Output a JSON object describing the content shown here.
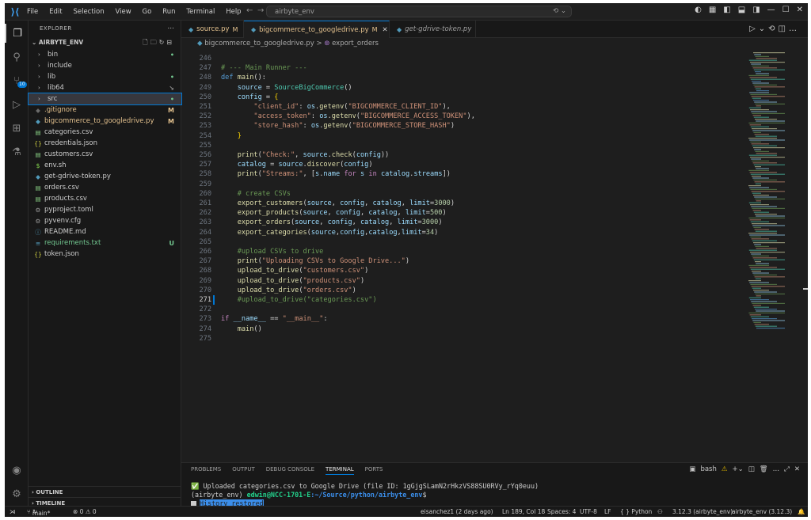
{
  "title_bar": {
    "menu": [
      "File",
      "Edit",
      "Selection",
      "View",
      "Go",
      "Run",
      "Terminal",
      "Help"
    ],
    "command_center": "airbyte_env",
    "back_icon": "arrow-left-icon",
    "forward_icon": "arrow-right-icon"
  },
  "sidebar": {
    "title": "EXPLORER",
    "root": "AIRBYTE_ENV",
    "more": "...",
    "items": [
      {
        "name": "bin",
        "kind": "folder",
        "status": "•",
        "status_color": "#73c991"
      },
      {
        "name": "include",
        "kind": "folder",
        "status": "",
        "status_color": ""
      },
      {
        "name": "lib",
        "kind": "folder",
        "status": "•",
        "status_color": "#73c991"
      },
      {
        "name": "lib64",
        "kind": "folder",
        "status": "↘",
        "status_color": "#8b8b8b"
      },
      {
        "name": "src",
        "kind": "folder",
        "status": "•",
        "status_color": "#73c991"
      },
      {
        "name": ".gitignore",
        "kind": "file",
        "icon": "◆",
        "icon_color": "#6b6b6b",
        "status": "M",
        "status_color": "#e2c08d"
      },
      {
        "name": "bigcommerce_to_googledrive.py",
        "kind": "file",
        "icon": "◆",
        "icon_color": "#519aba",
        "status": "M",
        "status_color": "#e2c08d"
      },
      {
        "name": "categories.csv",
        "kind": "file",
        "icon": "▤",
        "icon_color": "#89d185",
        "status": "",
        "status_color": ""
      },
      {
        "name": "credentials.json",
        "kind": "file",
        "icon": "{}",
        "icon_color": "#cbcb41",
        "status": "",
        "status_color": ""
      },
      {
        "name": "customers.csv",
        "kind": "file",
        "icon": "▤",
        "icon_color": "#89d185",
        "status": "",
        "status_color": ""
      },
      {
        "name": "env.sh",
        "kind": "file",
        "icon": "$",
        "icon_color": "#89e051",
        "status": "",
        "status_color": ""
      },
      {
        "name": "get-gdrive-token.py",
        "kind": "file",
        "icon": "◆",
        "icon_color": "#519aba",
        "status": "",
        "status_color": ""
      },
      {
        "name": "orders.csv",
        "kind": "file",
        "icon": "▤",
        "icon_color": "#89d185",
        "status": "",
        "status_color": ""
      },
      {
        "name": "products.csv",
        "kind": "file",
        "icon": "▤",
        "icon_color": "#89d185",
        "status": "",
        "status_color": ""
      },
      {
        "name": "pyproject.toml",
        "kind": "file",
        "icon": "⚙",
        "icon_color": "#9d9d9d",
        "status": "",
        "status_color": ""
      },
      {
        "name": "pyvenv.cfg",
        "kind": "file",
        "icon": "⚙",
        "icon_color": "#9d9d9d",
        "status": "",
        "status_color": ""
      },
      {
        "name": "README.md",
        "kind": "file",
        "icon": "ⓘ",
        "icon_color": "#519aba",
        "status": "",
        "status_color": ""
      },
      {
        "name": "requirements.txt",
        "kind": "file",
        "icon": "≡",
        "icon_color": "#519aba",
        "status": "U",
        "status_color": "#73c991"
      },
      {
        "name": "token.json",
        "kind": "file",
        "icon": "{}",
        "icon_color": "#cbcb41",
        "status": "",
        "status_color": ""
      }
    ],
    "outline": "OUTLINE",
    "timeline": "TIMELINE"
  },
  "tabs": [
    {
      "label": "source.py",
      "modified": "M",
      "active": false
    },
    {
      "label": "bigcommerce_to_googledrive.py",
      "modified": "M",
      "active": true,
      "close": "✕"
    },
    {
      "label": "get-gdrive-token.py",
      "modified": "",
      "active": false
    }
  ],
  "breadcrumbs": {
    "file": "bigcommerce_to_googledrive.py",
    "sep": ">",
    "symbol": "export_orders"
  },
  "code_lines": [
    {
      "n": "246",
      "tokens": []
    },
    {
      "n": "247",
      "tokens": [
        [
          "c",
          "# --- Main Runner ---"
        ]
      ]
    },
    {
      "n": "248",
      "tokens": [
        [
          "k",
          "def"
        ],
        [
          "t",
          " "
        ],
        [
          "f",
          "main"
        ],
        [
          "t",
          "():"
        ]
      ]
    },
    {
      "n": "249",
      "tokens": [
        [
          "t",
          "    "
        ],
        [
          "v",
          "source"
        ],
        [
          "t",
          " = "
        ],
        [
          "cl",
          "SourceBigCommerce"
        ],
        [
          "t",
          "()"
        ]
      ]
    },
    {
      "n": "250",
      "tokens": [
        [
          "t",
          "    "
        ],
        [
          "v",
          "config"
        ],
        [
          "t",
          " = "
        ],
        [
          "p",
          "{"
        ]
      ]
    },
    {
      "n": "251",
      "tokens": [
        [
          "t",
          "        "
        ],
        [
          "s",
          "\"client_id\""
        ],
        [
          "t",
          ": "
        ],
        [
          "v",
          "os"
        ],
        [
          "t",
          "."
        ],
        [
          "f",
          "getenv"
        ],
        [
          "t",
          "("
        ],
        [
          "s",
          "\"BIGCOMMERCE_CLIENT_ID\""
        ],
        [
          "t",
          "),"
        ]
      ]
    },
    {
      "n": "252",
      "tokens": [
        [
          "t",
          "        "
        ],
        [
          "s",
          "\"access_token\""
        ],
        [
          "t",
          ": "
        ],
        [
          "v",
          "os"
        ],
        [
          "t",
          "."
        ],
        [
          "f",
          "getenv"
        ],
        [
          "t",
          "("
        ],
        [
          "s",
          "\"BIGCOMMERCE_ACCESS_TOKEN\""
        ],
        [
          "t",
          "),"
        ]
      ]
    },
    {
      "n": "253",
      "tokens": [
        [
          "t",
          "        "
        ],
        [
          "s",
          "\"store_hash\""
        ],
        [
          "t",
          ": "
        ],
        [
          "v",
          "os"
        ],
        [
          "t",
          "."
        ],
        [
          "f",
          "getenv"
        ],
        [
          "t",
          "("
        ],
        [
          "s",
          "\"BIGCOMMERCE_STORE_HASH\""
        ],
        [
          "t",
          ")"
        ]
      ]
    },
    {
      "n": "254",
      "tokens": [
        [
          "t",
          "    "
        ],
        [
          "p",
          "}"
        ]
      ]
    },
    {
      "n": "255",
      "tokens": []
    },
    {
      "n": "256",
      "tokens": [
        [
          "t",
          "    "
        ],
        [
          "f",
          "print"
        ],
        [
          "t",
          "("
        ],
        [
          "s",
          "\"Check:\""
        ],
        [
          "t",
          ", "
        ],
        [
          "v",
          "source"
        ],
        [
          "t",
          "."
        ],
        [
          "f",
          "check"
        ],
        [
          "t",
          "("
        ],
        [
          "v",
          "config"
        ],
        [
          "t",
          "))"
        ]
      ]
    },
    {
      "n": "257",
      "tokens": [
        [
          "t",
          "    "
        ],
        [
          "v",
          "catalog"
        ],
        [
          "t",
          " = "
        ],
        [
          "v",
          "source"
        ],
        [
          "t",
          "."
        ],
        [
          "f",
          "discover"
        ],
        [
          "t",
          "("
        ],
        [
          "v",
          "config"
        ],
        [
          "t",
          ")"
        ]
      ]
    },
    {
      "n": "258",
      "tokens": [
        [
          "t",
          "    "
        ],
        [
          "f",
          "print"
        ],
        [
          "t",
          "("
        ],
        [
          "s",
          "\"Streams:\""
        ],
        [
          "t",
          ", ["
        ],
        [
          "v",
          "s"
        ],
        [
          "t",
          "."
        ],
        [
          "v",
          "name"
        ],
        [
          "t",
          " "
        ],
        [
          "kp",
          "for"
        ],
        [
          "t",
          " "
        ],
        [
          "v",
          "s"
        ],
        [
          "t",
          " "
        ],
        [
          "kp",
          "in"
        ],
        [
          "t",
          " "
        ],
        [
          "v",
          "catalog"
        ],
        [
          "t",
          "."
        ],
        [
          "v",
          "streams"
        ],
        [
          "t",
          "])"
        ]
      ]
    },
    {
      "n": "259",
      "tokens": []
    },
    {
      "n": "260",
      "tokens": [
        [
          "t",
          "    "
        ],
        [
          "c",
          "# create CSVs"
        ]
      ]
    },
    {
      "n": "261",
      "tokens": [
        [
          "t",
          "    "
        ],
        [
          "f",
          "export_customers"
        ],
        [
          "t",
          "("
        ],
        [
          "v",
          "source"
        ],
        [
          "t",
          ", "
        ],
        [
          "v",
          "config"
        ],
        [
          "t",
          ", "
        ],
        [
          "v",
          "catalog"
        ],
        [
          "t",
          ", "
        ],
        [
          "v",
          "limit"
        ],
        [
          "t",
          "="
        ],
        [
          "nu",
          "3000"
        ],
        [
          "t",
          ")"
        ]
      ]
    },
    {
      "n": "262",
      "tokens": [
        [
          "t",
          "    "
        ],
        [
          "f",
          "export_products"
        ],
        [
          "t",
          "("
        ],
        [
          "v",
          "source"
        ],
        [
          "t",
          ", "
        ],
        [
          "v",
          "config"
        ],
        [
          "t",
          ", "
        ],
        [
          "v",
          "catalog"
        ],
        [
          "t",
          ", "
        ],
        [
          "v",
          "limit"
        ],
        [
          "t",
          "="
        ],
        [
          "nu",
          "500"
        ],
        [
          "t",
          ")"
        ]
      ]
    },
    {
      "n": "263",
      "tokens": [
        [
          "t",
          "    "
        ],
        [
          "f",
          "export_orders"
        ],
        [
          "t",
          "("
        ],
        [
          "v",
          "source"
        ],
        [
          "t",
          ", "
        ],
        [
          "v",
          "config"
        ],
        [
          "t",
          ", "
        ],
        [
          "v",
          "catalog"
        ],
        [
          "t",
          ", "
        ],
        [
          "v",
          "limit"
        ],
        [
          "t",
          "="
        ],
        [
          "nu",
          "3000"
        ],
        [
          "t",
          ")"
        ]
      ]
    },
    {
      "n": "264",
      "tokens": [
        [
          "t",
          "    "
        ],
        [
          "f",
          "export_categories"
        ],
        [
          "t",
          "("
        ],
        [
          "v",
          "source"
        ],
        [
          "t",
          ","
        ],
        [
          "v",
          "config"
        ],
        [
          "t",
          ","
        ],
        [
          "v",
          "catalog"
        ],
        [
          "t",
          ","
        ],
        [
          "v",
          "limit"
        ],
        [
          "t",
          "="
        ],
        [
          "nu",
          "34"
        ],
        [
          "t",
          ")"
        ]
      ]
    },
    {
      "n": "265",
      "tokens": []
    },
    {
      "n": "266",
      "tokens": [
        [
          "t",
          "    "
        ],
        [
          "c",
          "#upload CSVs to drive"
        ]
      ]
    },
    {
      "n": "267",
      "tokens": [
        [
          "t",
          "    "
        ],
        [
          "f",
          "print"
        ],
        [
          "t",
          "("
        ],
        [
          "s",
          "\"Uploading CSVs to Google Drive...\""
        ],
        [
          "t",
          ")"
        ]
      ]
    },
    {
      "n": "268",
      "tokens": [
        [
          "t",
          "    "
        ],
        [
          "f",
          "upload_to_drive"
        ],
        [
          "t",
          "("
        ],
        [
          "s",
          "\"customers.csv\""
        ],
        [
          "t",
          ")"
        ]
      ]
    },
    {
      "n": "269",
      "tokens": [
        [
          "t",
          "    "
        ],
        [
          "f",
          "upload_to_drive"
        ],
        [
          "t",
          "("
        ],
        [
          "s",
          "\"products.csv\""
        ],
        [
          "t",
          ")"
        ]
      ]
    },
    {
      "n": "270",
      "tokens": [
        [
          "t",
          "    "
        ],
        [
          "f",
          "upload_to_drive"
        ],
        [
          "t",
          "("
        ],
        [
          "s",
          "\"orders.csv\""
        ],
        [
          "t",
          ")"
        ]
      ]
    },
    {
      "n": "271",
      "tokens": [
        [
          "t",
          "    "
        ],
        [
          "c",
          "#upload_to_drive(\"categories.csv\")"
        ]
      ]
    },
    {
      "n": "272",
      "tokens": []
    },
    {
      "n": "273",
      "tokens": [
        [
          "kp",
          "if"
        ],
        [
          "t",
          " "
        ],
        [
          "v",
          "__name__"
        ],
        [
          "t",
          " == "
        ],
        [
          "s",
          "\"__main__\""
        ],
        [
          "t",
          ":"
        ]
      ]
    },
    {
      "n": "274",
      "tokens": [
        [
          "t",
          "    "
        ],
        [
          "f",
          "main"
        ],
        [
          "t",
          "()"
        ]
      ]
    },
    {
      "n": "275",
      "tokens": []
    }
  ],
  "panel": {
    "tabs": [
      "PROBLEMS",
      "OUTPUT",
      "DEBUG CONSOLE",
      "TERMINAL",
      "PORTS"
    ],
    "active_tab": "TERMINAL",
    "shell": "bash",
    "terminal_line1_check": "✅",
    "terminal_line1": "Uploaded categories.csv to Google Drive (file ID: 1gGjgSLamN2rHkzVS88SU0RVy_rYq0euu)",
    "prompt_env": "(airbyte_env)",
    "prompt_user": "edwin@NCC-1701-E",
    "prompt_path": ":~/Source/python/airbyte_env",
    "prompt_symbol": "$",
    "history": "History restored"
  },
  "status_bar": {
    "branch": "main*",
    "errors": "⊗ 0 ⚠ 0",
    "blame": "eisanchez1 (2 days ago)",
    "position": "Ln 189, Col 18",
    "spaces": "Spaces: 4",
    "encoding": "UTF-8",
    "eol": "LF",
    "language": "{ } Python",
    "interpreter": "3.12.3 (airbyte_env)",
    "env_label": "airbyte_env (3.12.3)"
  }
}
